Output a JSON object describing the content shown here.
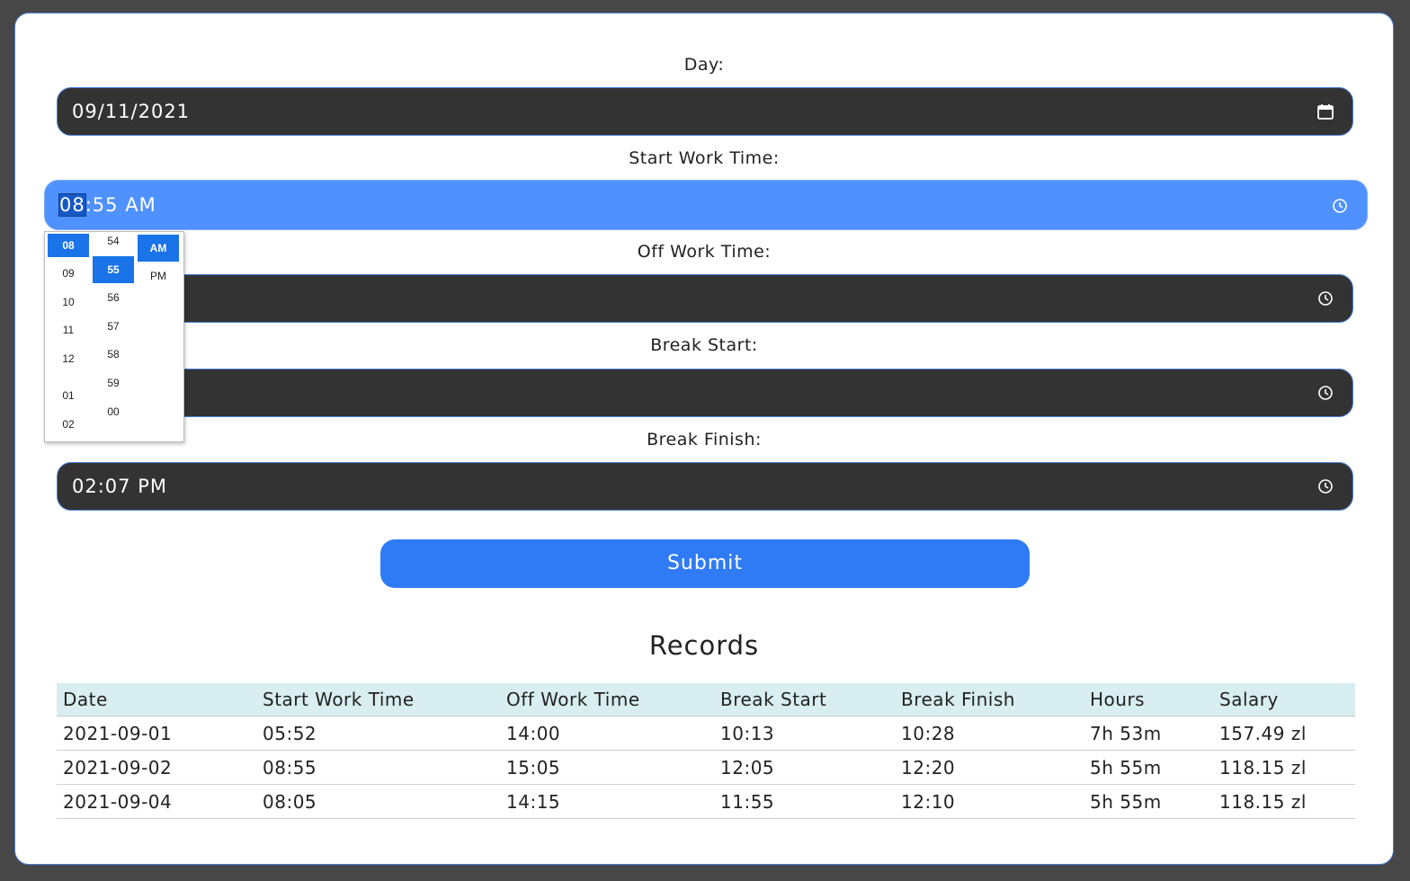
{
  "form": {
    "day_label": "Day:",
    "day_value": "09/11/2021",
    "start_label": "Start Work Time:",
    "start_hour": "08",
    "start_rest": ":55 AM",
    "off_label": "Off Work Time:",
    "off_value": "",
    "break_start_label": "Break Start:",
    "break_start_value": "",
    "break_finish_label": "Break Finish:",
    "break_finish_value": "02:07 PM",
    "submit_label": "Submit"
  },
  "time_picker": {
    "hours": [
      "08",
      "09",
      "10",
      "11",
      "12",
      "01",
      "02"
    ],
    "selected_hour": "08",
    "minutes": [
      "54",
      "55",
      "56",
      "57",
      "58",
      "59",
      "00"
    ],
    "selected_minute": "55",
    "periods": [
      "AM",
      "PM"
    ],
    "selected_period": "AM"
  },
  "records": {
    "title": "Records",
    "columns": [
      "Date",
      "Start Work Time",
      "Off Work Time",
      "Break Start",
      "Break Finish",
      "Hours",
      "Salary"
    ],
    "rows": [
      [
        "2021-09-01",
        "05:52",
        "14:00",
        "10:13",
        "10:28",
        "7h 53m",
        "157.49 zl"
      ],
      [
        "2021-09-02",
        "08:55",
        "15:05",
        "12:05",
        "12:20",
        "5h 55m",
        "118.15 zl"
      ],
      [
        "2021-09-04",
        "08:05",
        "14:15",
        "11:55",
        "12:10",
        "5h 55m",
        "118.15 zl"
      ]
    ]
  },
  "colors": {
    "accent": "#2f7bf5",
    "active_field": "#4f91ff",
    "field_bg": "#333333",
    "table_header_bg": "#d8eef0",
    "page_bg": "#474747"
  }
}
